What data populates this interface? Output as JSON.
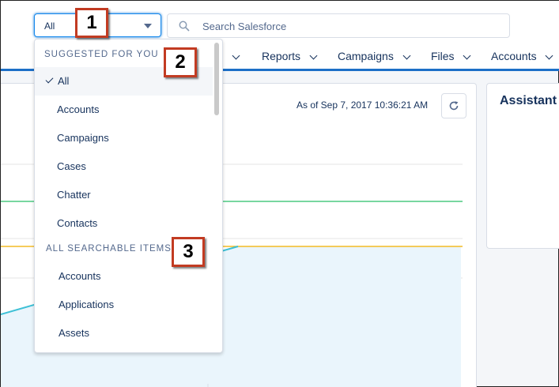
{
  "header": {
    "scope_value": "All",
    "search_placeholder": "Search Salesforce"
  },
  "nav": {
    "items": [
      {
        "label": "Reports"
      },
      {
        "label": "Campaigns"
      },
      {
        "label": "Files"
      },
      {
        "label": "Accounts"
      }
    ]
  },
  "card": {
    "as_of": "As of Sep 7, 2017 10:36:21 AM"
  },
  "assistant": {
    "title": "Assistant"
  },
  "dropdown": {
    "suggested_header": "SUGGESTED FOR YOU",
    "suggested": [
      {
        "label": "All",
        "selected": true
      },
      {
        "label": "Accounts"
      },
      {
        "label": "Campaigns"
      },
      {
        "label": "Cases"
      },
      {
        "label": "Chatter"
      },
      {
        "label": "Contacts"
      }
    ],
    "all_header": "ALL SEARCHABLE ITEMS",
    "all_items": [
      {
        "label": "Accounts"
      },
      {
        "label": "Applications"
      },
      {
        "label": "Assets"
      }
    ]
  },
  "callouts": [
    "1",
    "2",
    "3"
  ],
  "colors": {
    "brand_blue": "#1c6fc7",
    "focus_blue": "#1589ee",
    "callout_border": "#c23b22",
    "chart_green": "#4bca81",
    "chart_orange": "#f4bc25",
    "chart_cyan": "#3ec0d6",
    "chart_fill": "#eaf5fc"
  },
  "icons": [
    "search-icon",
    "chevron-down-icon",
    "refresh-icon",
    "checkmark-icon"
  ]
}
